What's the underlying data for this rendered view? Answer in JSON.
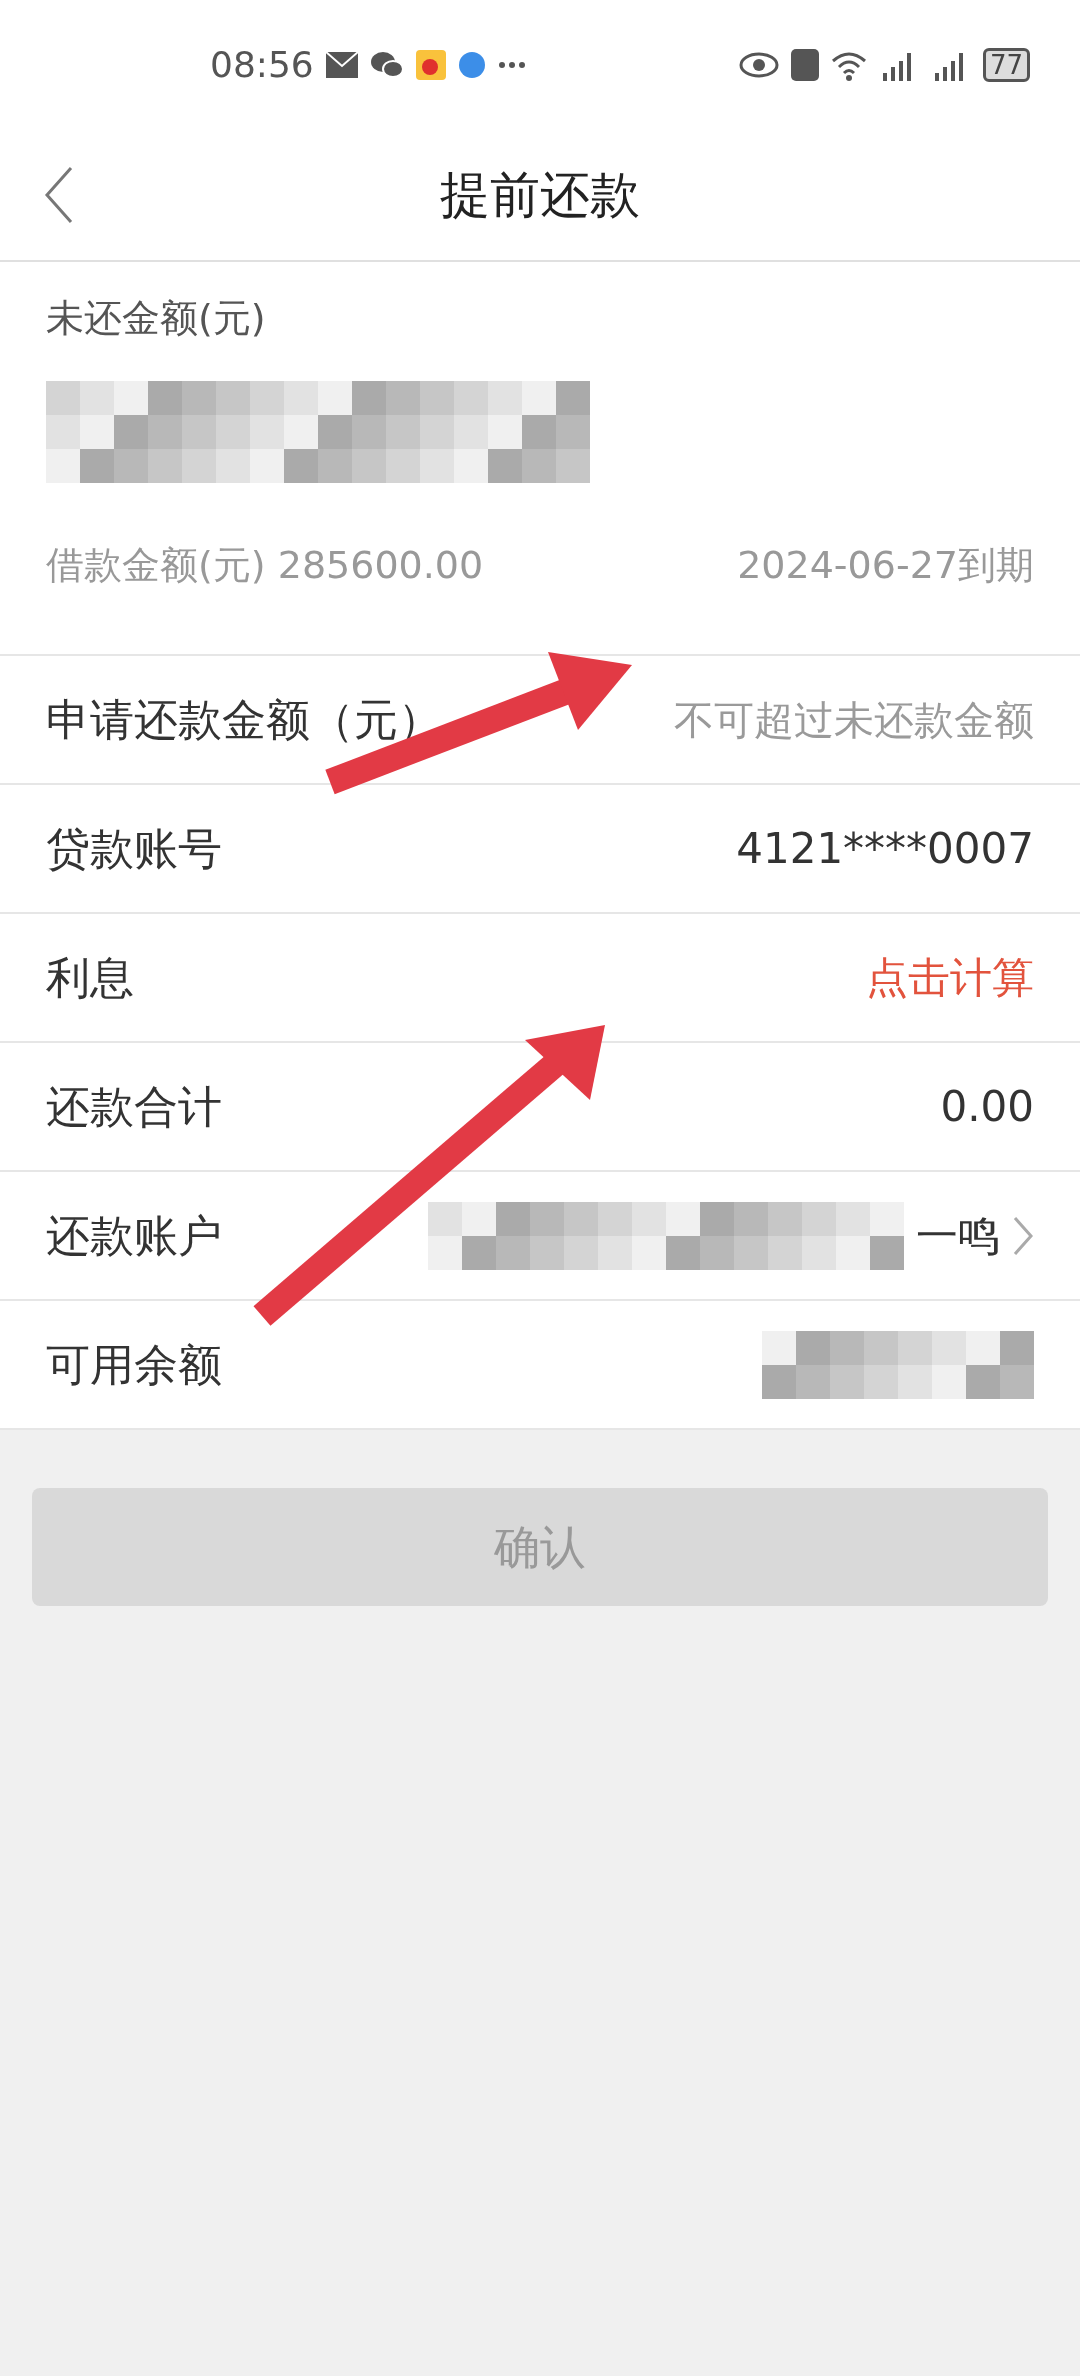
{
  "status_bar": {
    "time": "08:56",
    "battery": "77"
  },
  "header": {
    "title": "提前还款"
  },
  "summary": {
    "label": "未还金额(元)",
    "loan_text": "借款金额(元) 285600.00",
    "due": "2024-06-27到期"
  },
  "rows": [
    {
      "kind": "input",
      "label": "申请还款金额（元）",
      "placeholder": "不可超过未还款金额"
    },
    {
      "kind": "value",
      "label": "贷款账号",
      "value": "4121****0007"
    },
    {
      "kind": "link",
      "label": "利息",
      "value": "点击计算"
    },
    {
      "kind": "value",
      "label": "还款合计",
      "value": "0.00"
    },
    {
      "kind": "account",
      "label": "还款账户",
      "value": "一鸣"
    },
    {
      "kind": "hidden",
      "label": "可用余额"
    }
  ],
  "confirm": {
    "label": "确认",
    "disabled": true
  }
}
